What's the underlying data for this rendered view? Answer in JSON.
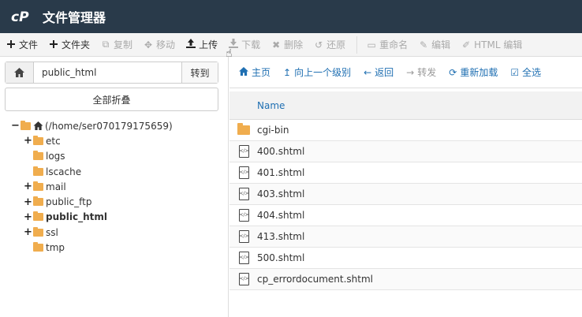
{
  "app": {
    "title": "文件管理器"
  },
  "toolbar": {
    "buttons": [
      {
        "label": "文件",
        "icon": "plus-icon",
        "enabled": true
      },
      {
        "label": "文件夹",
        "icon": "plus-icon",
        "enabled": true
      },
      {
        "label": "复制",
        "icon": "copy-icon",
        "enabled": false
      },
      {
        "label": "移动",
        "icon": "move-icon",
        "enabled": false
      },
      {
        "label": "上传",
        "icon": "upload-icon",
        "enabled": true
      },
      {
        "label": "下载",
        "icon": "download-icon",
        "enabled": false
      },
      {
        "label": "删除",
        "icon": "delete-icon",
        "enabled": false
      },
      {
        "label": "还原",
        "icon": "restore-icon",
        "enabled": false
      },
      {
        "label": "重命名",
        "icon": "rename-icon",
        "enabled": false
      },
      {
        "label": "编辑",
        "icon": "edit-icon",
        "enabled": false
      },
      {
        "label": "HTML 编辑",
        "icon": "html-edit-icon",
        "enabled": false
      }
    ]
  },
  "sidebar": {
    "path_value": "public_html",
    "goto_label": "转到",
    "collapse_label": "全部折叠",
    "tree": {
      "root": "(/home/ser070179175659)",
      "items": [
        {
          "label": "etc",
          "expandable": true,
          "bold": false
        },
        {
          "label": "logs",
          "expandable": false,
          "bold": false
        },
        {
          "label": "lscache",
          "expandable": false,
          "bold": false
        },
        {
          "label": "mail",
          "expandable": true,
          "bold": false
        },
        {
          "label": "public_ftp",
          "expandable": true,
          "bold": false
        },
        {
          "label": "public_html",
          "expandable": true,
          "bold": true
        },
        {
          "label": "ssl",
          "expandable": true,
          "bold": false
        },
        {
          "label": "tmp",
          "expandable": false,
          "bold": false
        }
      ]
    }
  },
  "nav": {
    "home": "主页",
    "up": "向上一个级别",
    "back": "返回",
    "forward": "转发",
    "reload": "重新加载",
    "select_all": "全选"
  },
  "files": {
    "header_name": "Name",
    "rows": [
      {
        "name": "cgi-bin",
        "type": "folder"
      },
      {
        "name": "400.shtml",
        "type": "file"
      },
      {
        "name": "401.shtml",
        "type": "file"
      },
      {
        "name": "403.shtml",
        "type": "file"
      },
      {
        "name": "404.shtml",
        "type": "file"
      },
      {
        "name": "413.shtml",
        "type": "file"
      },
      {
        "name": "500.shtml",
        "type": "file"
      },
      {
        "name": "cp_errordocument.shtml",
        "type": "file"
      }
    ]
  },
  "colors": {
    "topbar": "#293a4a",
    "link": "#1f6fb2",
    "folder": "#f0ad4e"
  }
}
